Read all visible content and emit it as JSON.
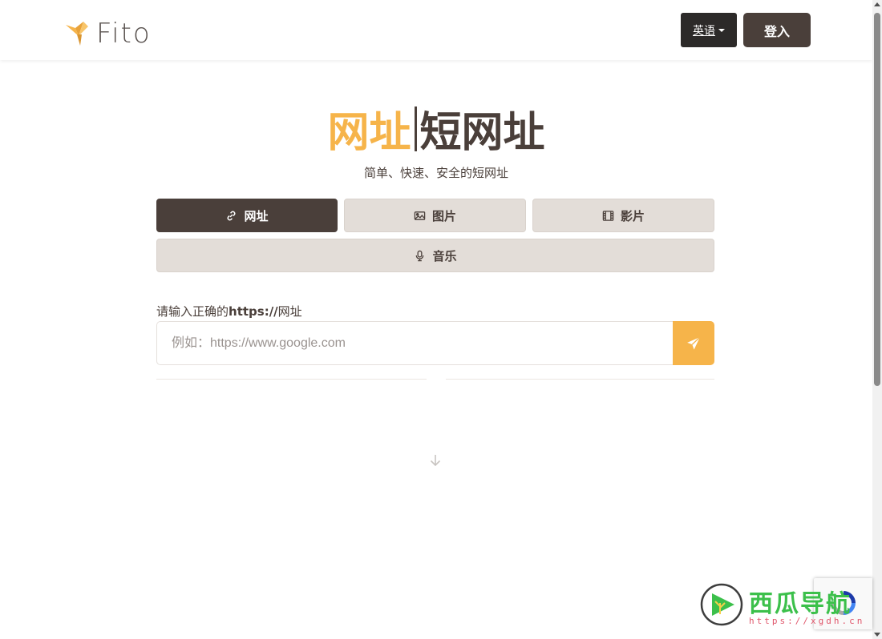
{
  "header": {
    "logo_text": "Fito",
    "language_label": "英语",
    "login_label": "登入"
  },
  "hero": {
    "title_highlight": "网址",
    "title_main": "短网址",
    "subtitle": "简单、快速、安全的短网址"
  },
  "tabs": [
    {
      "label": "网址",
      "icon": "link-icon",
      "active": true
    },
    {
      "label": "图片",
      "icon": "image-icon",
      "active": false
    },
    {
      "label": "影片",
      "icon": "film-icon",
      "active": false
    },
    {
      "label": "音乐",
      "icon": "microphone-icon",
      "active": false
    }
  ],
  "form": {
    "label_prefix": "请输入正确的",
    "label_bold": "https://",
    "label_suffix": "网址",
    "placeholder": "例如：https://www.google.com",
    "value": ""
  },
  "watermark": {
    "text": "西瓜导航",
    "url": "https://xgdh.cn"
  },
  "colors": {
    "accent": "#f6b44a",
    "primary": "#4a3f3a",
    "tab_bg": "#e3ddd8",
    "lang_bg": "#2c2a29"
  }
}
